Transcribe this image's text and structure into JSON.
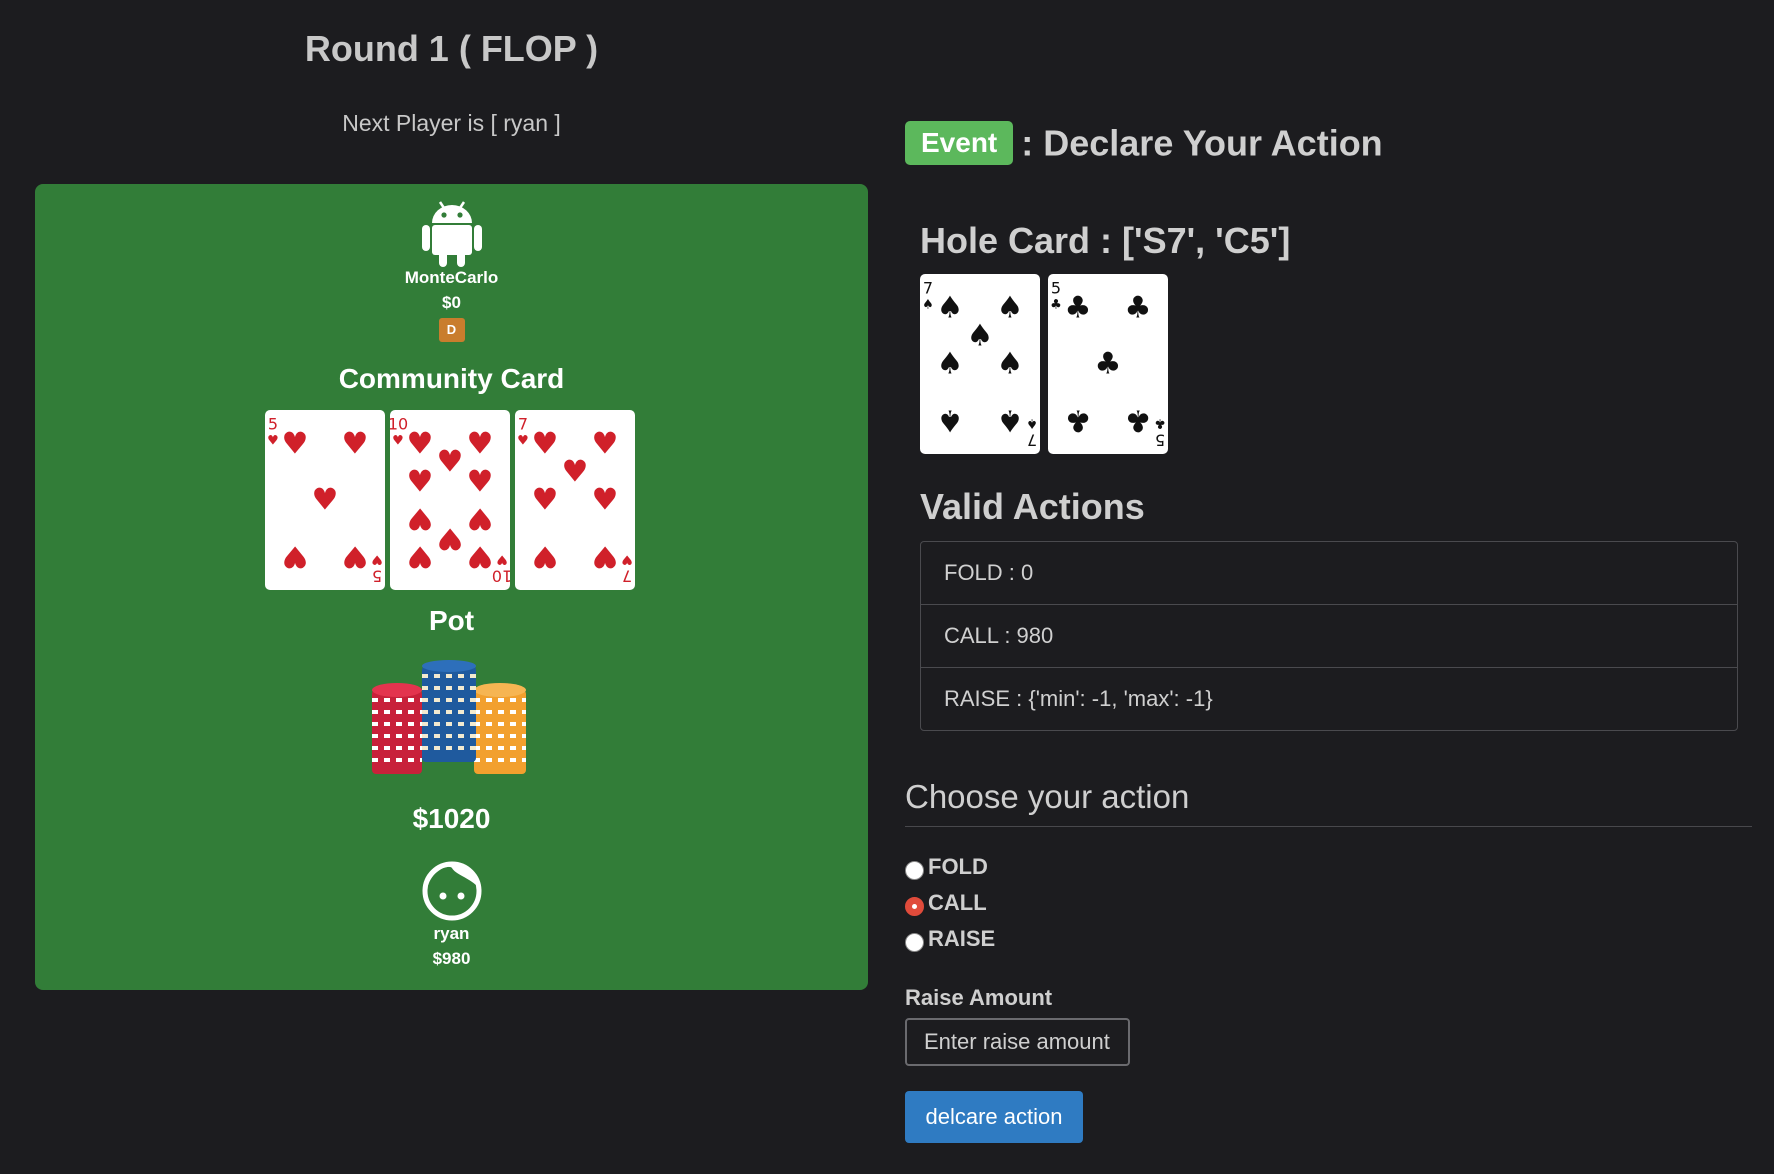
{
  "round_title": "Round 1 ( FLOP )",
  "next_player": "Next Player is [ ryan ]",
  "table": {
    "opponent": {
      "icon": "android-icon",
      "name": "MonteCarlo",
      "stack": "$0",
      "dealer_badge": "D"
    },
    "community_label": "Community Card",
    "community_cards": [
      {
        "rank": "5",
        "suit": "hearts"
      },
      {
        "rank": "10",
        "suit": "hearts"
      },
      {
        "rank": "7",
        "suit": "hearts"
      }
    ],
    "pot_label": "Pot",
    "pot_amount": "$1020",
    "player": {
      "icon": "face-icon",
      "name": "ryan",
      "stack": "$980"
    }
  },
  "event": {
    "badge": "Event",
    "title": ": Declare Your Action"
  },
  "hole": {
    "title": "Hole Card : ['S7', 'C5']",
    "cards": [
      {
        "rank": "7",
        "suit": "spades"
      },
      {
        "rank": "5",
        "suit": "clubs"
      }
    ]
  },
  "valid_actions": {
    "title": "Valid Actions",
    "items": [
      "FOLD : 0",
      "CALL : 980",
      "RAISE : {'min': -1, 'max': -1}"
    ]
  },
  "choose": {
    "legend": "Choose your action",
    "options": [
      {
        "label": "FOLD",
        "checked": false
      },
      {
        "label": "CALL",
        "checked": true
      },
      {
        "label": "RAISE",
        "checked": false
      }
    ],
    "raise_label": "Raise Amount",
    "raise_placeholder": "Enter raise amount",
    "button_label": "delcare action"
  },
  "colors": {
    "background": "#1c1c1f",
    "table_green": "#327d38",
    "event_badge": "#5cb85c",
    "button_blue": "#2f7bc2",
    "dealer_badge": "#c97d2d",
    "radio_checked": "#e04b3b"
  }
}
